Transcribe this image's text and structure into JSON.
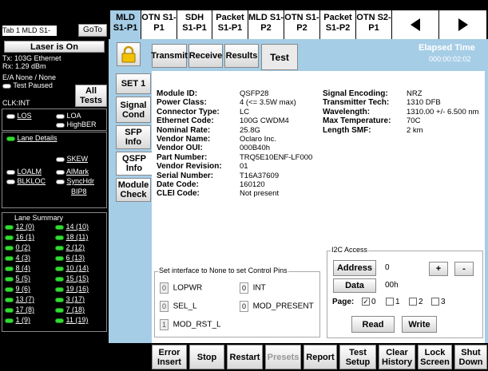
{
  "header": {
    "title": "Tab 1 MLD S1-P1",
    "goto": "GoTo"
  },
  "tabs": [
    {
      "label": "MLD S1-P1"
    },
    {
      "label": "OTN S1-P1"
    },
    {
      "label": "SDH S1-P1"
    },
    {
      "label": "Packet S1-P1"
    },
    {
      "label": "MLD S1-P2"
    },
    {
      "label": "OTN S1-P2"
    },
    {
      "label": "Packet S1-P2"
    },
    {
      "label": "OTN S2-P1"
    }
  ],
  "left": {
    "laser": "Laser is On",
    "tx": "Tx: 103G Ethernet",
    "rx": "Rx: 1.29 dBm",
    "ea": "E/A None / None",
    "test_paused": "Test Paused",
    "clk": "CLK:INT",
    "all_tests": "All Tests",
    "los": "LOS",
    "loa": "LOA",
    "highber": "HighBER",
    "lane_details": "Lane Details",
    "skew": "SKEW",
    "loalm": "LOALM",
    "almark": "AlMark",
    "blkloc": "BLKLOC",
    "synchdr": "SyncHdr",
    "bip8": "BIP8",
    "lane_summary_title": "Lane Summary",
    "lanes_left": [
      "12 (0)",
      "16 (1)",
      "0 (2)",
      "4 (3)",
      "8 (4)",
      "5 (5)",
      "9 (6)",
      "13 (7)",
      "17 (8)",
      "1 (9)"
    ],
    "lanes_right": [
      "14 (10)",
      "18 (11)",
      "2 (12)",
      "6 (13)",
      "10 (14)",
      "15 (15)",
      "19 (16)",
      "3 (17)",
      "7 (18)",
      "11 (19)"
    ]
  },
  "subtabs": [
    "Transmit",
    "Receive",
    "Results",
    "Test"
  ],
  "elapsed": {
    "label": "Elapsed Time",
    "value": "000:00:02:02"
  },
  "side": [
    "SET 1",
    "Signal Cond",
    "SFP Info",
    "QSFP Info",
    "Module Check"
  ],
  "info_left": [
    {
      "k": "Module ID:",
      "v": "QSFP28"
    },
    {
      "k": "Power Class:",
      "v": "4 (<= 3.5W max)"
    },
    {
      "k": "Connector Type:",
      "v": "LC"
    },
    {
      "k": "Ethernet Code:",
      "v": "100G CWDM4"
    },
    {
      "k": "Nominal Rate:",
      "v": "25.8G"
    },
    {
      "k": "Vendor Name:",
      "v": "Oclaro Inc."
    },
    {
      "k": "Vendor OUI:",
      "v": "000B40h"
    },
    {
      "k": "Part Number:",
      "v": "TRQ5E10ENF-LF000"
    },
    {
      "k": "Vendor Revision:",
      "v": "01"
    },
    {
      "k": "Serial Number:",
      "v": "T16A37609"
    },
    {
      "k": "Date Code:",
      "v": "160120"
    },
    {
      "k": "CLEI Code:",
      "v": "Not present"
    }
  ],
  "info_right": [
    {
      "k": "Signal Encoding:",
      "v": "NRZ"
    },
    {
      "k": "Transmitter Tech:",
      "v": "1310 DFB"
    },
    {
      "k": "Wavelength:",
      "v": "1310.00 +/- 6.500 nm"
    },
    {
      "k": "Max Temperature:",
      "v": "70C"
    },
    {
      "k": "Length SMF:",
      "v": "2 km"
    }
  ],
  "pins": {
    "legend": "Set interface to None to set Control Pins",
    "lopwr": "LOPWR",
    "lopwr_v": "0",
    "int": "INT",
    "int_v": "0",
    "sel_l": "SEL_L",
    "sel_l_v": "0",
    "mod_present": "MOD_PRESENT",
    "mod_present_v": "0",
    "mod_rst": "MOD_RST_L",
    "mod_rst_v": "1"
  },
  "i2c": {
    "legend": "I2C Access",
    "address": "Address",
    "address_v": "0",
    "plus": "+",
    "minus": "-",
    "data": "Data",
    "data_v": "00h",
    "page": "Page:",
    "p0": "0",
    "p1": "1",
    "p2": "2",
    "p3": "3",
    "read": "Read",
    "write": "Write"
  },
  "bottom": [
    "Error Insert",
    "Stop",
    "Restart",
    "Presets",
    "Report",
    "Test Setup",
    "Clear History",
    "Lock Screen",
    "Shut Down"
  ]
}
